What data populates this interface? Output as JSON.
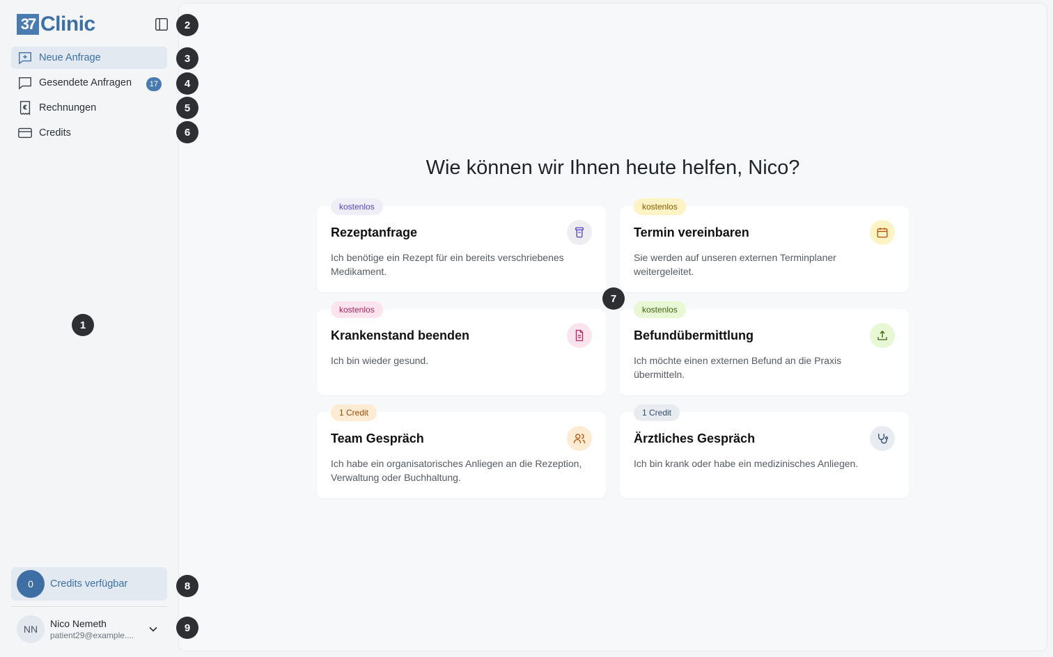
{
  "app": {
    "logo_mark": "37",
    "logo_text": "Clinic"
  },
  "sidebar": {
    "items": [
      {
        "label": "Neue Anfrage",
        "icon": "message-plus-icon",
        "active": true
      },
      {
        "label": "Gesendete Anfragen",
        "icon": "message-icon",
        "badge": "17"
      },
      {
        "label": "Rechnungen",
        "icon": "receipt-euro-icon"
      },
      {
        "label": "Credits",
        "icon": "credit-card-icon"
      }
    ],
    "credits": {
      "count": "0",
      "label": "Credits verfügbar"
    },
    "user": {
      "initials": "NN",
      "name": "Nico Nemeth",
      "email": "patient29@example...."
    }
  },
  "main": {
    "headline": "Wie können wir Ihnen heute helfen, Nico?",
    "cards": [
      {
        "tag": "kostenlos",
        "title": "Rezeptanfrage",
        "description": "Ich benötige ein Rezept für ein bereits verschriebenes Medikament.",
        "icon": "pill-bottle-icon",
        "tag_bg": "#efeef7",
        "tag_color": "#5b3fc4",
        "icon_bg": "#eeeef2",
        "icon_color": "#5b3fc4"
      },
      {
        "tag": "kostenlos",
        "title": "Termin vereinbaren",
        "description": "Sie werden auf unseren externen Terminplaner weitergeleitet.",
        "icon": "calendar-icon",
        "tag_bg": "#fdf3c4",
        "tag_color": "#8a5a00",
        "icon_bg": "#fdf3c4",
        "icon_color": "#b45309"
      },
      {
        "tag": "kostenlos",
        "title": "Krankenstand beenden",
        "description": "Ich bin wieder gesund.",
        "icon": "document-icon",
        "tag_bg": "#fce4ef",
        "tag_color": "#b0245d",
        "icon_bg": "#fce4ef",
        "icon_color": "#c2255c"
      },
      {
        "tag": "kostenlos",
        "title": "Befundübermittlung",
        "description": "Ich möchte einen externen Befund an die Praxis übermitteln.",
        "icon": "upload-icon",
        "tag_bg": "#e8f7d4",
        "tag_color": "#3f6212",
        "icon_bg": "#e8f7d4",
        "icon_color": "#3f6212"
      },
      {
        "tag": "1 Credit",
        "title": "Team Gespräch",
        "description": "Ich habe ein organisatorisches Anliegen an die Rezeption, Verwaltung oder Buchhaltung.",
        "icon": "users-icon",
        "tag_bg": "#fdebd3",
        "tag_color": "#9a4a08",
        "icon_bg": "#fdebd3",
        "icon_color": "#b45309"
      },
      {
        "tag": "1 Credit",
        "title": "Ärztliches Gespräch",
        "description": "Ich bin krank oder habe ein medizinisches Anliegen.",
        "icon": "stethoscope-icon",
        "tag_bg": "#e8ecf1",
        "tag_color": "#2f4a6b",
        "icon_bg": "#e8ecf1",
        "icon_color": "#2f4a6b"
      }
    ]
  },
  "markers": [
    "1",
    "2",
    "3",
    "4",
    "5",
    "6",
    "7",
    "8",
    "9"
  ]
}
